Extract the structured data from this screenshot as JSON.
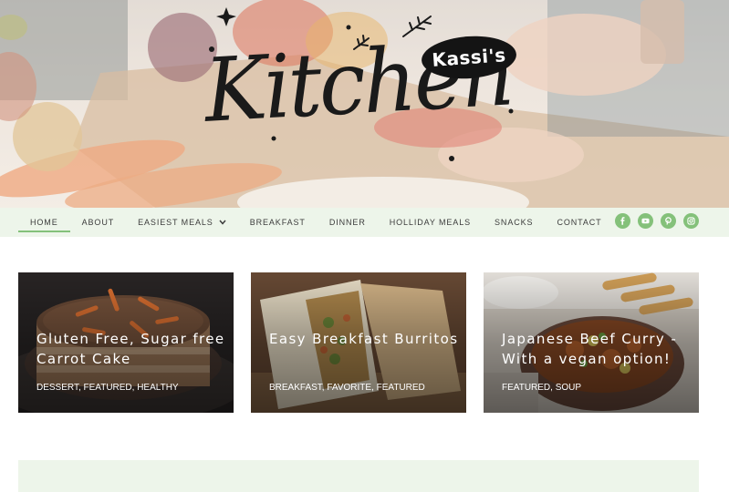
{
  "logo": {
    "wordmark": "Kitchen",
    "badge": "Kassi's"
  },
  "nav": {
    "items": [
      {
        "label": "HOME",
        "active": true
      },
      {
        "label": "ABOUT"
      },
      {
        "label": "EASIEST MEALS",
        "dropdown": true
      },
      {
        "label": "BREAKFAST"
      },
      {
        "label": "DINNER"
      },
      {
        "label": "HOLLIDAY MEALS"
      },
      {
        "label": "SNACKS"
      },
      {
        "label": "CONTACT"
      }
    ],
    "socials": [
      "facebook-icon",
      "youtube-icon",
      "pinterest-icon",
      "instagram-icon"
    ]
  },
  "cards": [
    {
      "title": "Gluten Free, Sugar free Carrot Cake",
      "tags": "DESSERT, FEATURED, HEALTHY"
    },
    {
      "title": "Easy Breakfast Burritos",
      "tags": "BREAKFAST, FAVORITE, FEATURED"
    },
    {
      "title": "Japanese Beef Curry - With a vegan option!",
      "tags": "FEATURED, SOUP"
    }
  ],
  "colors": {
    "accent": "#84c17a",
    "nav_bg": "#edf5ea",
    "text": "#3c3c3c"
  }
}
